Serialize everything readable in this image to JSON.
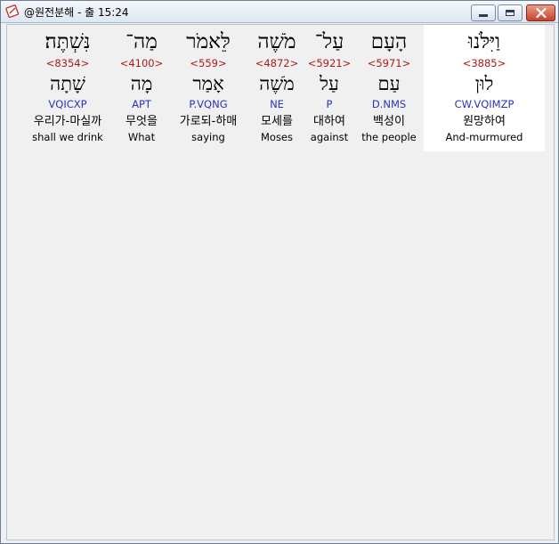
{
  "window": {
    "title": "@원전분해 - 출 15:24",
    "icon": "bible-app-icon"
  },
  "words": [
    {
      "hebrew": "וַיִּלֹּנוּ",
      "strong": "<3885>",
      "lemma": "לוּן",
      "morph": "CW.VQIMZP",
      "korean": "원망하여",
      "english": "And-murmured",
      "selected": true
    },
    {
      "hebrew": "הָעָם",
      "strong": "<5971>",
      "lemma": "עַם",
      "morph": "D.NMS",
      "korean": "백성이",
      "english": "the people",
      "selected": false
    },
    {
      "hebrew": "עַל־",
      "strong": "<5921>",
      "lemma": "עַל",
      "morph": "P",
      "korean": "대하여",
      "english": "against",
      "selected": false
    },
    {
      "hebrew": "מֹשֶׁה",
      "strong": "<4872>",
      "lemma": "מֹשֶׁה",
      "morph": "NE",
      "korean": "모세를",
      "english": "Moses",
      "selected": false
    },
    {
      "hebrew": "לֵּאמֹר",
      "strong": "<559>",
      "lemma": "אָמַר",
      "morph": "P.VQNG",
      "korean": "가로되-하매",
      "english": "saying",
      "selected": false
    },
    {
      "hebrew": "מַה־",
      "strong": "<4100>",
      "lemma": "מָה",
      "morph": "APT",
      "korean": "무엇을",
      "english": "What",
      "selected": false
    },
    {
      "hebrew": "נִּשְׁתֶּה׃",
      "strong": "<8354>",
      "lemma": "שָׁתָה",
      "morph": "VQICXP",
      "korean": "우리가-마실까",
      "english": "shall we drink",
      "selected": false
    }
  ],
  "colors": {
    "strong": "#b01818",
    "morph": "#2832b8",
    "selected_bg": "#ffffff"
  }
}
